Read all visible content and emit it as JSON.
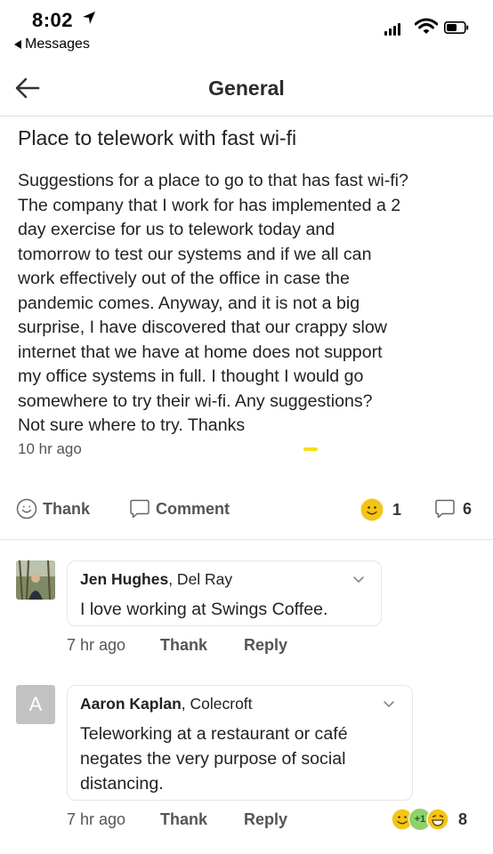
{
  "status_bar": {
    "time": "8:02",
    "back_app": "Messages"
  },
  "header": {
    "title": "General"
  },
  "post": {
    "title": "Place to telework with fast wi-fi",
    "body": "Suggestions for a place to go to that has fast wi-fi?\nThe company that I work for has implemented a 2\nday exercise for us to telework today and\ntomorrow to test our systems and if we all can\nwork effectively out of the office in case the\npandemic comes. Anyway, and it is not a big\nsurprise, I have discovered that our crappy slow\ninternet that we have at home does not support\nmy office systems in full.  I thought I would go\nsomewhere to try their wi-fi. Any suggestions?\nNot sure where to try. Thanks",
    "time": "10 hr ago",
    "actions": {
      "thank": "Thank",
      "comment": "Comment"
    },
    "reaction_count": "1",
    "comment_count": "6"
  },
  "comments": [
    {
      "author": "Jen Hughes",
      "location": ", Del Ray",
      "text": "I love working at Swings Coffee.",
      "time": "7 hr ago",
      "thank": "Thank",
      "reply": "Reply"
    },
    {
      "avatar_letter": "A",
      "author": "Aaron Kaplan",
      "location": ", Colecroft",
      "text": "Teleworking at a restaurant or café\nnegates the very purpose of social\ndistancing.",
      "time": "7 hr ago",
      "thank": "Thank",
      "reply": "Reply",
      "plus_one": "+1",
      "reaction_count": "8"
    }
  ],
  "colors": {
    "accent_yellow": "#f5c417",
    "plus_one_green": "#8fd16b",
    "avatar_gray": "#c2c2c2"
  }
}
